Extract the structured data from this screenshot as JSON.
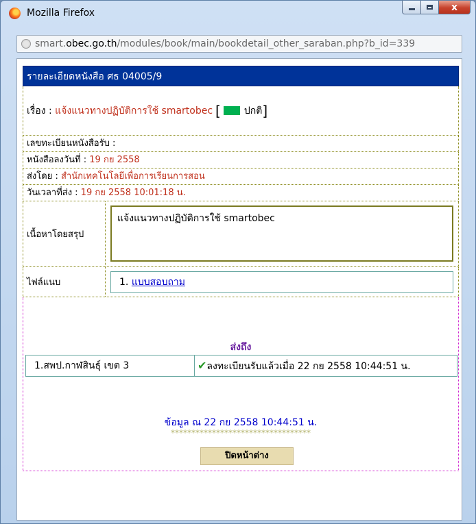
{
  "window": {
    "title": "Mozilla Firefox",
    "close_glyph": "x"
  },
  "url": {
    "prefix": "smart.",
    "host": "obec.go.th",
    "path": "/modules/book/main/bookdetail_other_saraban.php?b_id=339"
  },
  "doc": {
    "header": "รายละเอียดหนังสือ ศธ 04005/9",
    "subject_label": "เรื่อง :",
    "subject_value": "แจ้งแนวทางปฏิบัติการใช้ smartobec",
    "status_label": "ปกติ",
    "status_color": "#00b050",
    "reg_label": "เลขทะเบียนหนังสือรับ :",
    "date_label": "หนังสือลงวันที่ :",
    "date_value": "19 กย 2558",
    "sender_label": "ส่งโดย :",
    "sender_value": "สำนักเทคโนโลยีเพื่อการเรียนการสอน",
    "sent_time_label": "วันเวลาที่ส่ง :",
    "sent_time_value": "19 กย 2558 10:01:18 น.",
    "summary_label": "เนื้อหาโดยสรุป",
    "summary_value": "แจ้งแนวทางปฏิบัติการใช้ smartobec",
    "attach_label": "ไฟล์แนบ",
    "attach_index": "1.",
    "attach_link": "แบบสอบถาม"
  },
  "recipients": {
    "title": "ส่งถึง",
    "rows": [
      {
        "name": "1.สพป.กาฬสินธุ์ เขต 3",
        "status": "ลงทะเบียนรับแล้วเมื่อ 22 กย 2558 10:44:51 น."
      }
    ],
    "info": "ข้อมูล ณ 22 กย 2558 10:44:51 น.",
    "stars": "**********************************",
    "close_button": "ปิดหน้าต่าง"
  }
}
